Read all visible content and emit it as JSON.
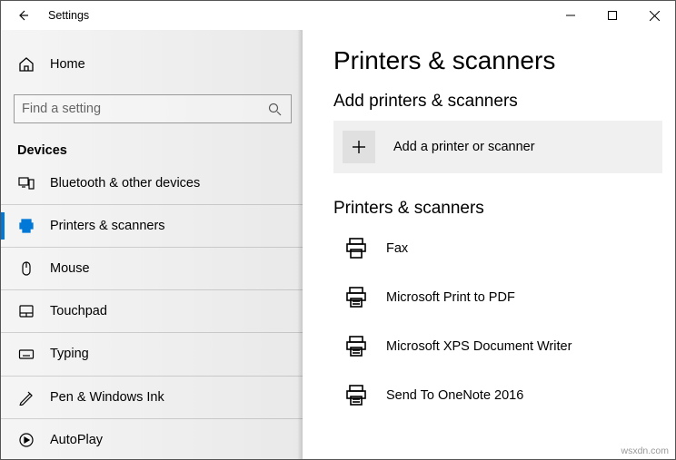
{
  "window": {
    "title": "Settings"
  },
  "sidebar": {
    "home_label": "Home",
    "search_placeholder": "Find a setting",
    "category_label": "Devices",
    "items": [
      {
        "label": "Bluetooth & other devices"
      },
      {
        "label": "Printers & scanners"
      },
      {
        "label": "Mouse"
      },
      {
        "label": "Touchpad"
      },
      {
        "label": "Typing"
      },
      {
        "label": "Pen & Windows Ink"
      },
      {
        "label": "AutoPlay"
      }
    ]
  },
  "page": {
    "title": "Printers & scanners",
    "add_section_title": "Add printers & scanners",
    "add_button_label": "Add a printer or scanner",
    "list_section_title": "Printers & scanners",
    "printers": [
      {
        "label": "Fax"
      },
      {
        "label": "Microsoft Print to PDF"
      },
      {
        "label": "Microsoft XPS Document Writer"
      },
      {
        "label": "Send To OneNote 2016"
      }
    ]
  },
  "watermark": "wsxdn.com"
}
